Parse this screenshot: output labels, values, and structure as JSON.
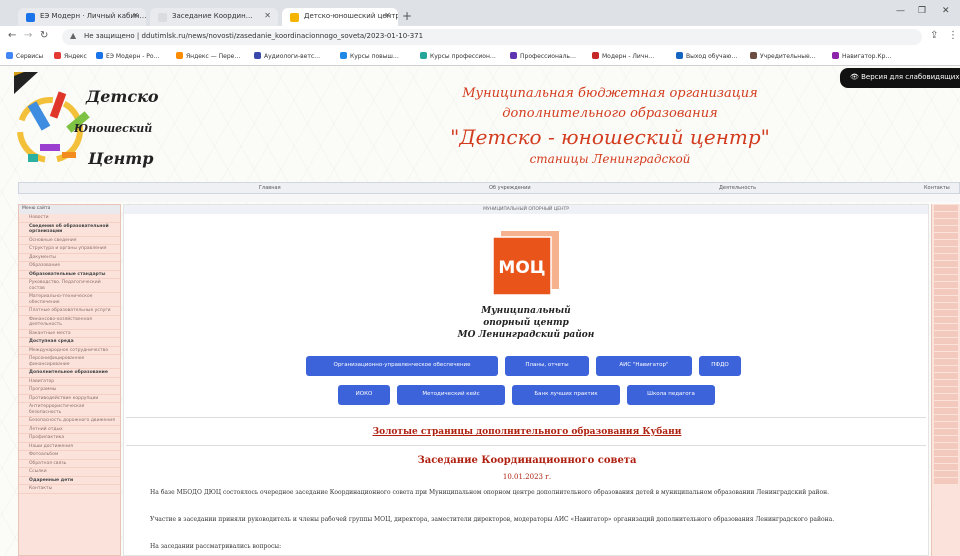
{
  "browser": {
    "tabs": [
      {
        "title": "ЕЭ Модерн · Личный кабин…",
        "color": "#1a73e8"
      },
      {
        "title": "Заседание Координ…",
        "color": "#dadce0"
      },
      {
        "title": "Детско-юношеский центр · Ле…",
        "color": "#f4b400"
      }
    ],
    "url": "Не защищено | ddutimlsk.ru/news/novosti/zasedanie_koordinacionnogo_soveta/2023-01-10-371",
    "bookmarks": [
      {
        "label": "Сервисы",
        "color": "#4285f4"
      },
      {
        "label": "Яндекс",
        "color": "#e53935"
      },
      {
        "label": "ЕЭ Модерн - Ро…",
        "color": "#1a73e8"
      },
      {
        "label": "Яндекс — Пере…",
        "color": "#fb8c00"
      },
      {
        "label": "Аудиологи-ветс…",
        "color": "#3949ab"
      },
      {
        "label": "Курсы повыш…",
        "color": "#1e88e5"
      },
      {
        "label": "Курсы профессион…",
        "color": "#26a69a"
      },
      {
        "label": "Профессиональ…",
        "color": "#5e35b1"
      },
      {
        "label": "Модерн - Личн…",
        "color": "#c62828"
      },
      {
        "label": "Выход обучаю…",
        "color": "#1565c0"
      },
      {
        "label": "Учредительные…",
        "color": "#6d4c41"
      },
      {
        "label": "Навигатор.Кр…",
        "color": "#8e24aa"
      }
    ]
  },
  "header": {
    "vision_button": "Версия для слабовидящих",
    "logo_words": [
      "Детско",
      "Юношеский",
      "Центр"
    ],
    "title_lines": [
      "Муниципальная бюджетная организация",
      "дополнительного образования",
      "\"Детско - юношеский центр\"",
      "станицы Ленинградской"
    ],
    "menu": [
      "Главная",
      "Об учреждении",
      "Деятельность",
      "Контакты"
    ]
  },
  "left_menu": {
    "header": "Меню сайта",
    "items": [
      {
        "label": "Новости",
        "bold": false
      },
      {
        "label": "Сведения об образовательной организации",
        "bold": true
      },
      {
        "label": "Основные сведения",
        "bold": false
      },
      {
        "label": "Структура и органы управления",
        "bold": false
      },
      {
        "label": "Документы",
        "bold": false
      },
      {
        "label": "Образование",
        "bold": false
      },
      {
        "label": "Образовательные стандарты",
        "bold": true
      },
      {
        "label": "Руководство. Педагогический состав",
        "bold": false
      },
      {
        "label": "Материально-техническое обеспечение",
        "bold": false
      },
      {
        "label": "Платные образовательные услуги",
        "bold": false
      },
      {
        "label": "Финансово-хозяйственная деятельность",
        "bold": false
      },
      {
        "label": "Вакантные места",
        "bold": false
      },
      {
        "label": "Доступная среда",
        "bold": true
      },
      {
        "label": "Международное сотрудничество",
        "bold": false
      },
      {
        "label": "Персонифицированное финансирование",
        "bold": false
      },
      {
        "label": "Дополнительное образование",
        "bold": true
      },
      {
        "label": "Навигатор",
        "bold": false
      },
      {
        "label": "Программы",
        "bold": false
      },
      {
        "label": "Противодействие коррупции",
        "bold": false
      },
      {
        "label": "Антитеррористическая безопасность",
        "bold": false
      },
      {
        "label": "Безопасность дорожного движения",
        "bold": false
      },
      {
        "label": "Летний отдых",
        "bold": false
      },
      {
        "label": "Профилактика",
        "bold": false
      },
      {
        "label": "Наши достижения",
        "bold": false
      },
      {
        "label": "Фотоальбом",
        "bold": false
      },
      {
        "label": "Обратная связь",
        "bold": false
      },
      {
        "label": "Ссылки",
        "bold": false
      },
      {
        "label": "Одаренные дети",
        "bold": true
      },
      {
        "label": "Контакты",
        "bold": false
      }
    ]
  },
  "content": {
    "header": "МУНИЦИПАЛЬНЫЙ ОПОРНЫЙ ЦЕНТР",
    "moc_label": "МОЦ",
    "moc_sub_lines": [
      "Муниципальный",
      "опорный центр",
      "МО Ленинградский район"
    ],
    "buttons_row1": [
      "Организационно-управленческое обеспечение",
      "Планы, отчеты",
      "АИС \"Навигатор\"",
      "ПФДО"
    ],
    "buttons_row2": [
      "ИОКО",
      "Методический кейс",
      "Банк лучших практик",
      "Школа педагога"
    ],
    "golden_link": "Золотые страницы дополнительного образования Кубани",
    "session_title": "Заседание Координационного совета",
    "session_date": "10.01.2023 г.",
    "paragraphs": [
      "На базе МБОДО ДЮЦ состоялось очередное заседание Координационного совета при Муниципальном опорном центре дополнительного образования детей в муниципальном образовании Ленинградский район.",
      "Участие в заседании приняли руководитель и члены рабочей группы МОЦ, директора, заместители директоров, модераторы АИС «Навигатор» организаций дополнительного образования Ленинградского района.",
      "На заседании рассматривались вопросы:"
    ]
  }
}
